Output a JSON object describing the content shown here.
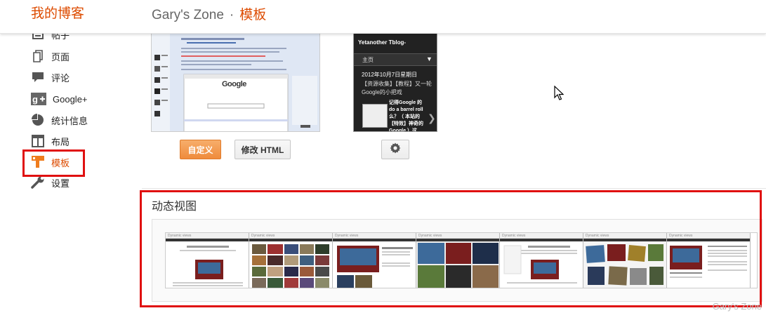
{
  "header": {
    "brand": "我的博客",
    "title": "Gary's Zone",
    "separator": "·",
    "subtitle": "模板"
  },
  "sidebar": {
    "items": [
      {
        "label": "帖子",
        "icon": "posts-icon"
      },
      {
        "label": "页面",
        "icon": "page-icon"
      },
      {
        "label": "评论",
        "icon": "comment-icon"
      },
      {
        "label": "Google+",
        "icon": "google-plus-icon"
      },
      {
        "label": "统计信息",
        "icon": "stats-pie-icon"
      },
      {
        "label": "布局",
        "icon": "layout-icon"
      },
      {
        "label": "模板",
        "icon": "template-icon",
        "active": true
      },
      {
        "label": "设置",
        "icon": "wrench-icon"
      }
    ]
  },
  "templates": {
    "live_thumb": {
      "logo_text": "Google"
    },
    "mobile_thumb": {
      "blog_title": "Yetanother Tblog-",
      "menu_label": "主页",
      "post_date": "2012年10月7日星期日",
      "post_title": "【资源收集】【教程】又一轮Google的小把戏",
      "post_excerpt": "记得Google 的 do a barrel roll么？（ 本站的【特效】神奇的Google ）这"
    },
    "customize_label": "自定义",
    "edit_html_label": "修改 HTML"
  },
  "dynamic_views": {
    "title": "动态视图",
    "panel_header": "Dynamic views"
  },
  "watermark": "Gary's Zone",
  "colors": {
    "accent": "#dd4b00",
    "highlight": "#e01010"
  }
}
